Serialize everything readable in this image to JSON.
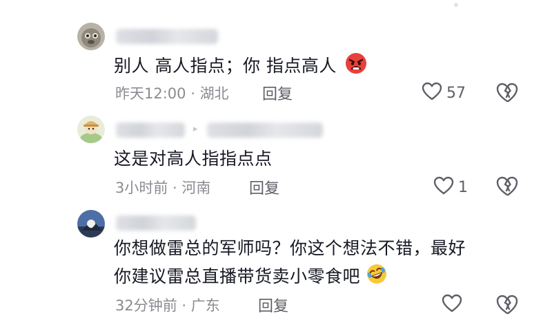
{
  "comments": [
    {
      "text": "别人 高人指点；你 指点高人",
      "emoji": "angry-face-emoji",
      "time": "昨天12:00",
      "location": "湖北",
      "reply_label": "回复",
      "likes": "57"
    },
    {
      "text": "这是对高人指指点点",
      "time": "3小时前",
      "location": "河南",
      "reply_label": "回复",
      "likes": "1"
    },
    {
      "text_line1": "你想做雷总的军师吗？你这个想法不错，最好",
      "text_line2": "你建议雷总直播带货卖小零食吧",
      "emoji": "rolling-laughing-emoji",
      "time": "32分钟前",
      "location": "广东",
      "reply_label": "回复",
      "likes": ""
    }
  ],
  "meta_separator": " · ",
  "colors": {
    "text": "#161823",
    "meta": "#8a8b91",
    "icon": "#5e5f66"
  }
}
